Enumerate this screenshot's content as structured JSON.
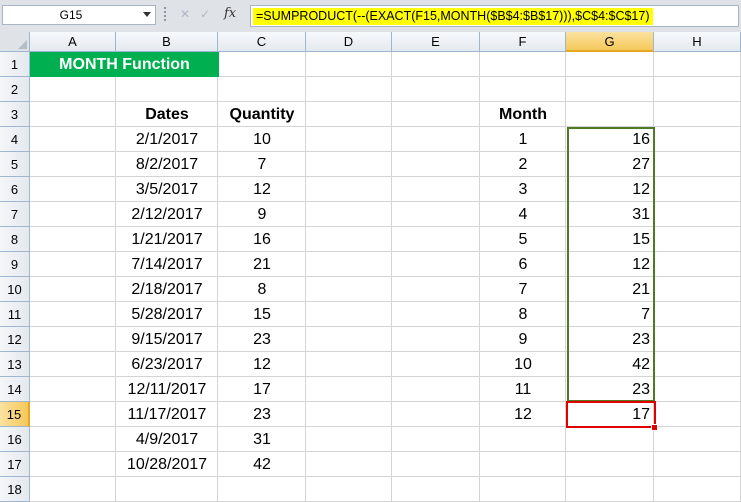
{
  "formula_bar": {
    "name_box": "G15",
    "fx_label": "fx",
    "formula": "=SUMPRODUCT(--(EXACT(F15,MONTH($B$4:$B$17))),$C$4:$C$17)"
  },
  "columns": [
    "A",
    "B",
    "C",
    "D",
    "E",
    "F",
    "G",
    "H"
  ],
  "rows": [
    "1",
    "2",
    "3",
    "4",
    "5",
    "6",
    "7",
    "8",
    "9",
    "10",
    "11",
    "12",
    "13",
    "14",
    "15",
    "16",
    "17",
    "18"
  ],
  "selected": {
    "column": "G",
    "row": "15"
  },
  "sheet": {
    "title": "MONTH Function",
    "title_color": "#00b050",
    "headers": {
      "dates": "Dates",
      "quantity": "Quantity",
      "month": "Month"
    },
    "data": [
      {
        "date": "2/1/2017",
        "qty": "10"
      },
      {
        "date": "8/2/2017",
        "qty": "7"
      },
      {
        "date": "3/5/2017",
        "qty": "12"
      },
      {
        "date": "2/12/2017",
        "qty": "9"
      },
      {
        "date": "1/21/2017",
        "qty": "16"
      },
      {
        "date": "7/14/2017",
        "qty": "21"
      },
      {
        "date": "2/18/2017",
        "qty": "8"
      },
      {
        "date": "5/28/2017",
        "qty": "15"
      },
      {
        "date": "9/15/2017",
        "qty": "23"
      },
      {
        "date": "6/23/2017",
        "qty": "12"
      },
      {
        "date": "12/11/2017",
        "qty": "17"
      },
      {
        "date": "11/17/2017",
        "qty": "23"
      },
      {
        "date": "4/9/2017",
        "qty": "31"
      },
      {
        "date": "10/28/2017",
        "qty": "42"
      }
    ],
    "months": [
      {
        "month": "1",
        "total": "16"
      },
      {
        "month": "2",
        "total": "27"
      },
      {
        "month": "3",
        "total": "12"
      },
      {
        "month": "4",
        "total": "31"
      },
      {
        "month": "5",
        "total": "15"
      },
      {
        "month": "6",
        "total": "12"
      },
      {
        "month": "7",
        "total": "21"
      },
      {
        "month": "8",
        "total": "7"
      },
      {
        "month": "9",
        "total": "23"
      },
      {
        "month": "10",
        "total": "42"
      },
      {
        "month": "11",
        "total": "23"
      },
      {
        "month": "12",
        "total": "17"
      }
    ]
  }
}
